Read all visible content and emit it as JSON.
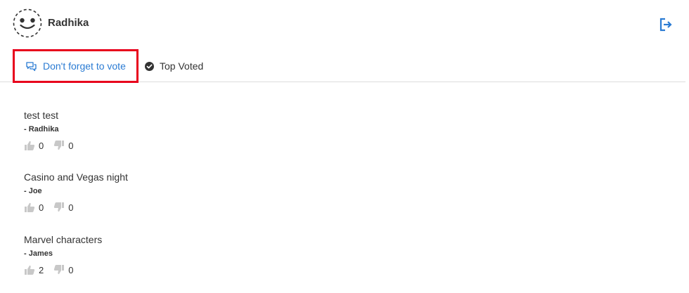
{
  "header": {
    "username": "Radhika",
    "avatar_icon": "smiley-face-icon",
    "logout_icon": "sign-out-icon",
    "accent_color": "#2a7bd3"
  },
  "tabs": [
    {
      "label": "Don't forget to vote",
      "icon": "comments-icon",
      "active": true
    },
    {
      "label": "Top Voted",
      "icon": "check-circle-icon",
      "active": false
    }
  ],
  "highlight_color": "#e8001c",
  "ideas": [
    {
      "title": "test test",
      "author": "- Radhika",
      "upvotes": "0",
      "downvotes": "0"
    },
    {
      "title": "Casino and Vegas night",
      "author": "- Joe",
      "upvotes": "0",
      "downvotes": "0"
    },
    {
      "title": "Marvel characters",
      "author": "- James",
      "upvotes": "2",
      "downvotes": "0"
    }
  ]
}
